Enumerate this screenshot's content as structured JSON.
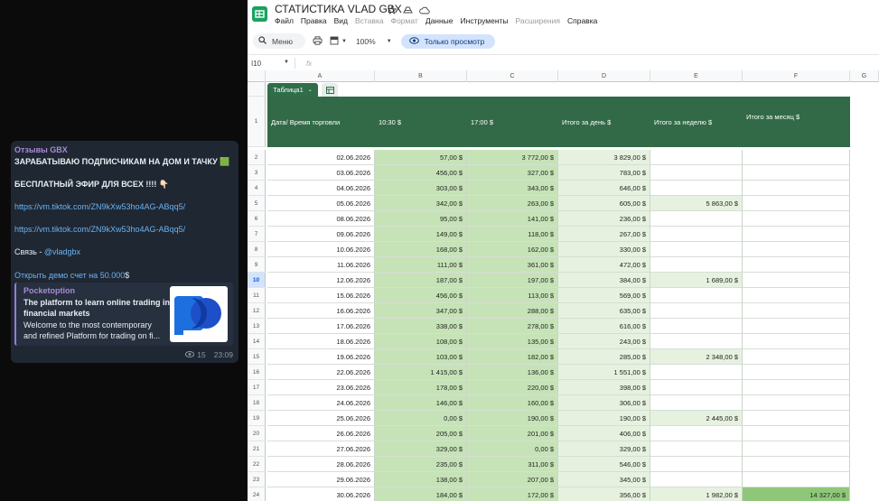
{
  "chat": {
    "author": "Отзывы GBX",
    "line1": "ЗАРАБАТЫВАЮ ПОДПИСЧИКАМ НА ДОМ И ТАЧКУ 🟩",
    "line2": "БЕСПЛАТНЫЙ ЭФИР ДЛЯ ВСЕХ !!!! 👇🏻",
    "link1": "https://vm.tiktok.com/ZN9kXw53ho4AG-ABqq5/",
    "link2": "https://vm.tiktok.com/ZN9kXw53ho4AG-ABqq5/",
    "contact_prefix": "Связь - ",
    "contact_handle": "@vladgbx",
    "demo_link": "Открыть демо счет на 50.000",
    "demo_suffix": "$",
    "preview": {
      "site": "Pocketoption",
      "title": "The platform to learn online trading in financial markets",
      "desc1": "Welcome to the most contemporary",
      "desc2": "and refined Platform for trading on fi..."
    },
    "views": "15",
    "time": "23:09"
  },
  "sheets": {
    "doc_title": "СТАТИСТИКА VLAD GBX",
    "menu": [
      "Файл",
      "Правка",
      "Вид",
      "Вставка",
      "Формат",
      "Данные",
      "Инструменты",
      "Расширения",
      "Справка"
    ],
    "menu_disabled": [
      false,
      false,
      false,
      true,
      true,
      false,
      false,
      true,
      false
    ],
    "toolbar": {
      "search": "Меню",
      "zoom": "100%",
      "view_only": "Только просмотр"
    },
    "namebox": "I10",
    "fx": "fx",
    "columns": [
      "A",
      "B",
      "C",
      "D",
      "E",
      "F",
      "G"
    ],
    "table_name": "Таблица1",
    "header": [
      "Дата/ Время торговли",
      "10:30 $",
      "17:00 $",
      "Итого за день $",
      "Итого за неделю $",
      "Итого за месяц $"
    ],
    "header_row_num": "1",
    "active_row": "10",
    "rows": [
      {
        "n": "2",
        "a": "02.06.2026",
        "b": "57,00 $",
        "c": "3 772,00 $",
        "d": "3 829,00 $",
        "e": "",
        "f": ""
      },
      {
        "n": "3",
        "a": "03.06.2026",
        "b": "456,00 $",
        "c": "327,00 $",
        "d": "783,00 $",
        "e": "",
        "f": ""
      },
      {
        "n": "4",
        "a": "04.06.2026",
        "b": "303,00 $",
        "c": "343,00 $",
        "d": "646,00 $",
        "e": "",
        "f": ""
      },
      {
        "n": "5",
        "a": "05.06.2026",
        "b": "342,00 $",
        "c": "263,00 $",
        "d": "605,00 $",
        "e": "5 863,00 $",
        "f": ""
      },
      {
        "n": "6",
        "a": "08.06.2026",
        "b": "95,00 $",
        "c": "141,00 $",
        "d": "236,00 $",
        "e": "",
        "f": ""
      },
      {
        "n": "7",
        "a": "09.06.2026",
        "b": "149,00 $",
        "c": "118,00 $",
        "d": "267,00 $",
        "e": "",
        "f": ""
      },
      {
        "n": "8",
        "a": "10.06.2026",
        "b": "168,00 $",
        "c": "162,00 $",
        "d": "330,00 $",
        "e": "",
        "f": ""
      },
      {
        "n": "9",
        "a": "11.06.2026",
        "b": "111,00 $",
        "c": "361,00 $",
        "d": "472,00 $",
        "e": "",
        "f": ""
      },
      {
        "n": "10",
        "a": "12.06.2026",
        "b": "187,00 $",
        "c": "197,00 $",
        "d": "384,00 $",
        "e": "1 689,00 $",
        "f": ""
      },
      {
        "n": "11",
        "a": "15.06.2026",
        "b": "456,00 $",
        "c": "113,00 $",
        "d": "569,00 $",
        "e": "",
        "f": ""
      },
      {
        "n": "12",
        "a": "16.06.2026",
        "b": "347,00 $",
        "c": "288,00 $",
        "d": "635,00 $",
        "e": "",
        "f": ""
      },
      {
        "n": "13",
        "a": "17.06.2026",
        "b": "338,00 $",
        "c": "278,00 $",
        "d": "616,00 $",
        "e": "",
        "f": ""
      },
      {
        "n": "14",
        "a": "18.06.2026",
        "b": "108,00 $",
        "c": "135,00 $",
        "d": "243,00 $",
        "e": "",
        "f": ""
      },
      {
        "n": "15",
        "a": "19.06.2026",
        "b": "103,00 $",
        "c": "182,00 $",
        "d": "285,00 $",
        "e": "2 348,00 $",
        "f": ""
      },
      {
        "n": "16",
        "a": "22.06.2026",
        "b": "1 415,00 $",
        "c": "136,00 $",
        "d": "1 551,00 $",
        "e": "",
        "f": ""
      },
      {
        "n": "17",
        "a": "23.06.2026",
        "b": "178,00 $",
        "c": "220,00 $",
        "d": "398,00 $",
        "e": "",
        "f": ""
      },
      {
        "n": "18",
        "a": "24.06.2026",
        "b": "146,00 $",
        "c": "160,00 $",
        "d": "306,00 $",
        "e": "",
        "f": ""
      },
      {
        "n": "19",
        "a": "25.06.2026",
        "b": "0,00 $",
        "c": "190,00 $",
        "d": "190,00 $",
        "e": "2 445,00 $",
        "f": ""
      },
      {
        "n": "20",
        "a": "26.06.2026",
        "b": "205,00 $",
        "c": "201,00 $",
        "d": "406,00 $",
        "e": "",
        "f": ""
      },
      {
        "n": "21",
        "a": "27.06.2026",
        "b": "329,00 $",
        "c": "0,00 $",
        "d": "329,00 $",
        "e": "",
        "f": ""
      },
      {
        "n": "22",
        "a": "28.06.2026",
        "b": "235,00 $",
        "c": "311,00 $",
        "d": "546,00 $",
        "e": "",
        "f": ""
      },
      {
        "n": "23",
        "a": "29.06.2026",
        "b": "138,00 $",
        "c": "207,00 $",
        "d": "345,00 $",
        "e": "",
        "f": ""
      },
      {
        "n": "24",
        "a": "30.06.2026",
        "b": "184,00 $",
        "c": "172,00 $",
        "d": "356,00 $",
        "e": "1 982,00 $",
        "f": "14 327,00 $"
      }
    ],
    "colors": {
      "header_green": "#326a47",
      "logo_green": "#1aa260",
      "view_only_bg": "#d3e3fd"
    }
  }
}
